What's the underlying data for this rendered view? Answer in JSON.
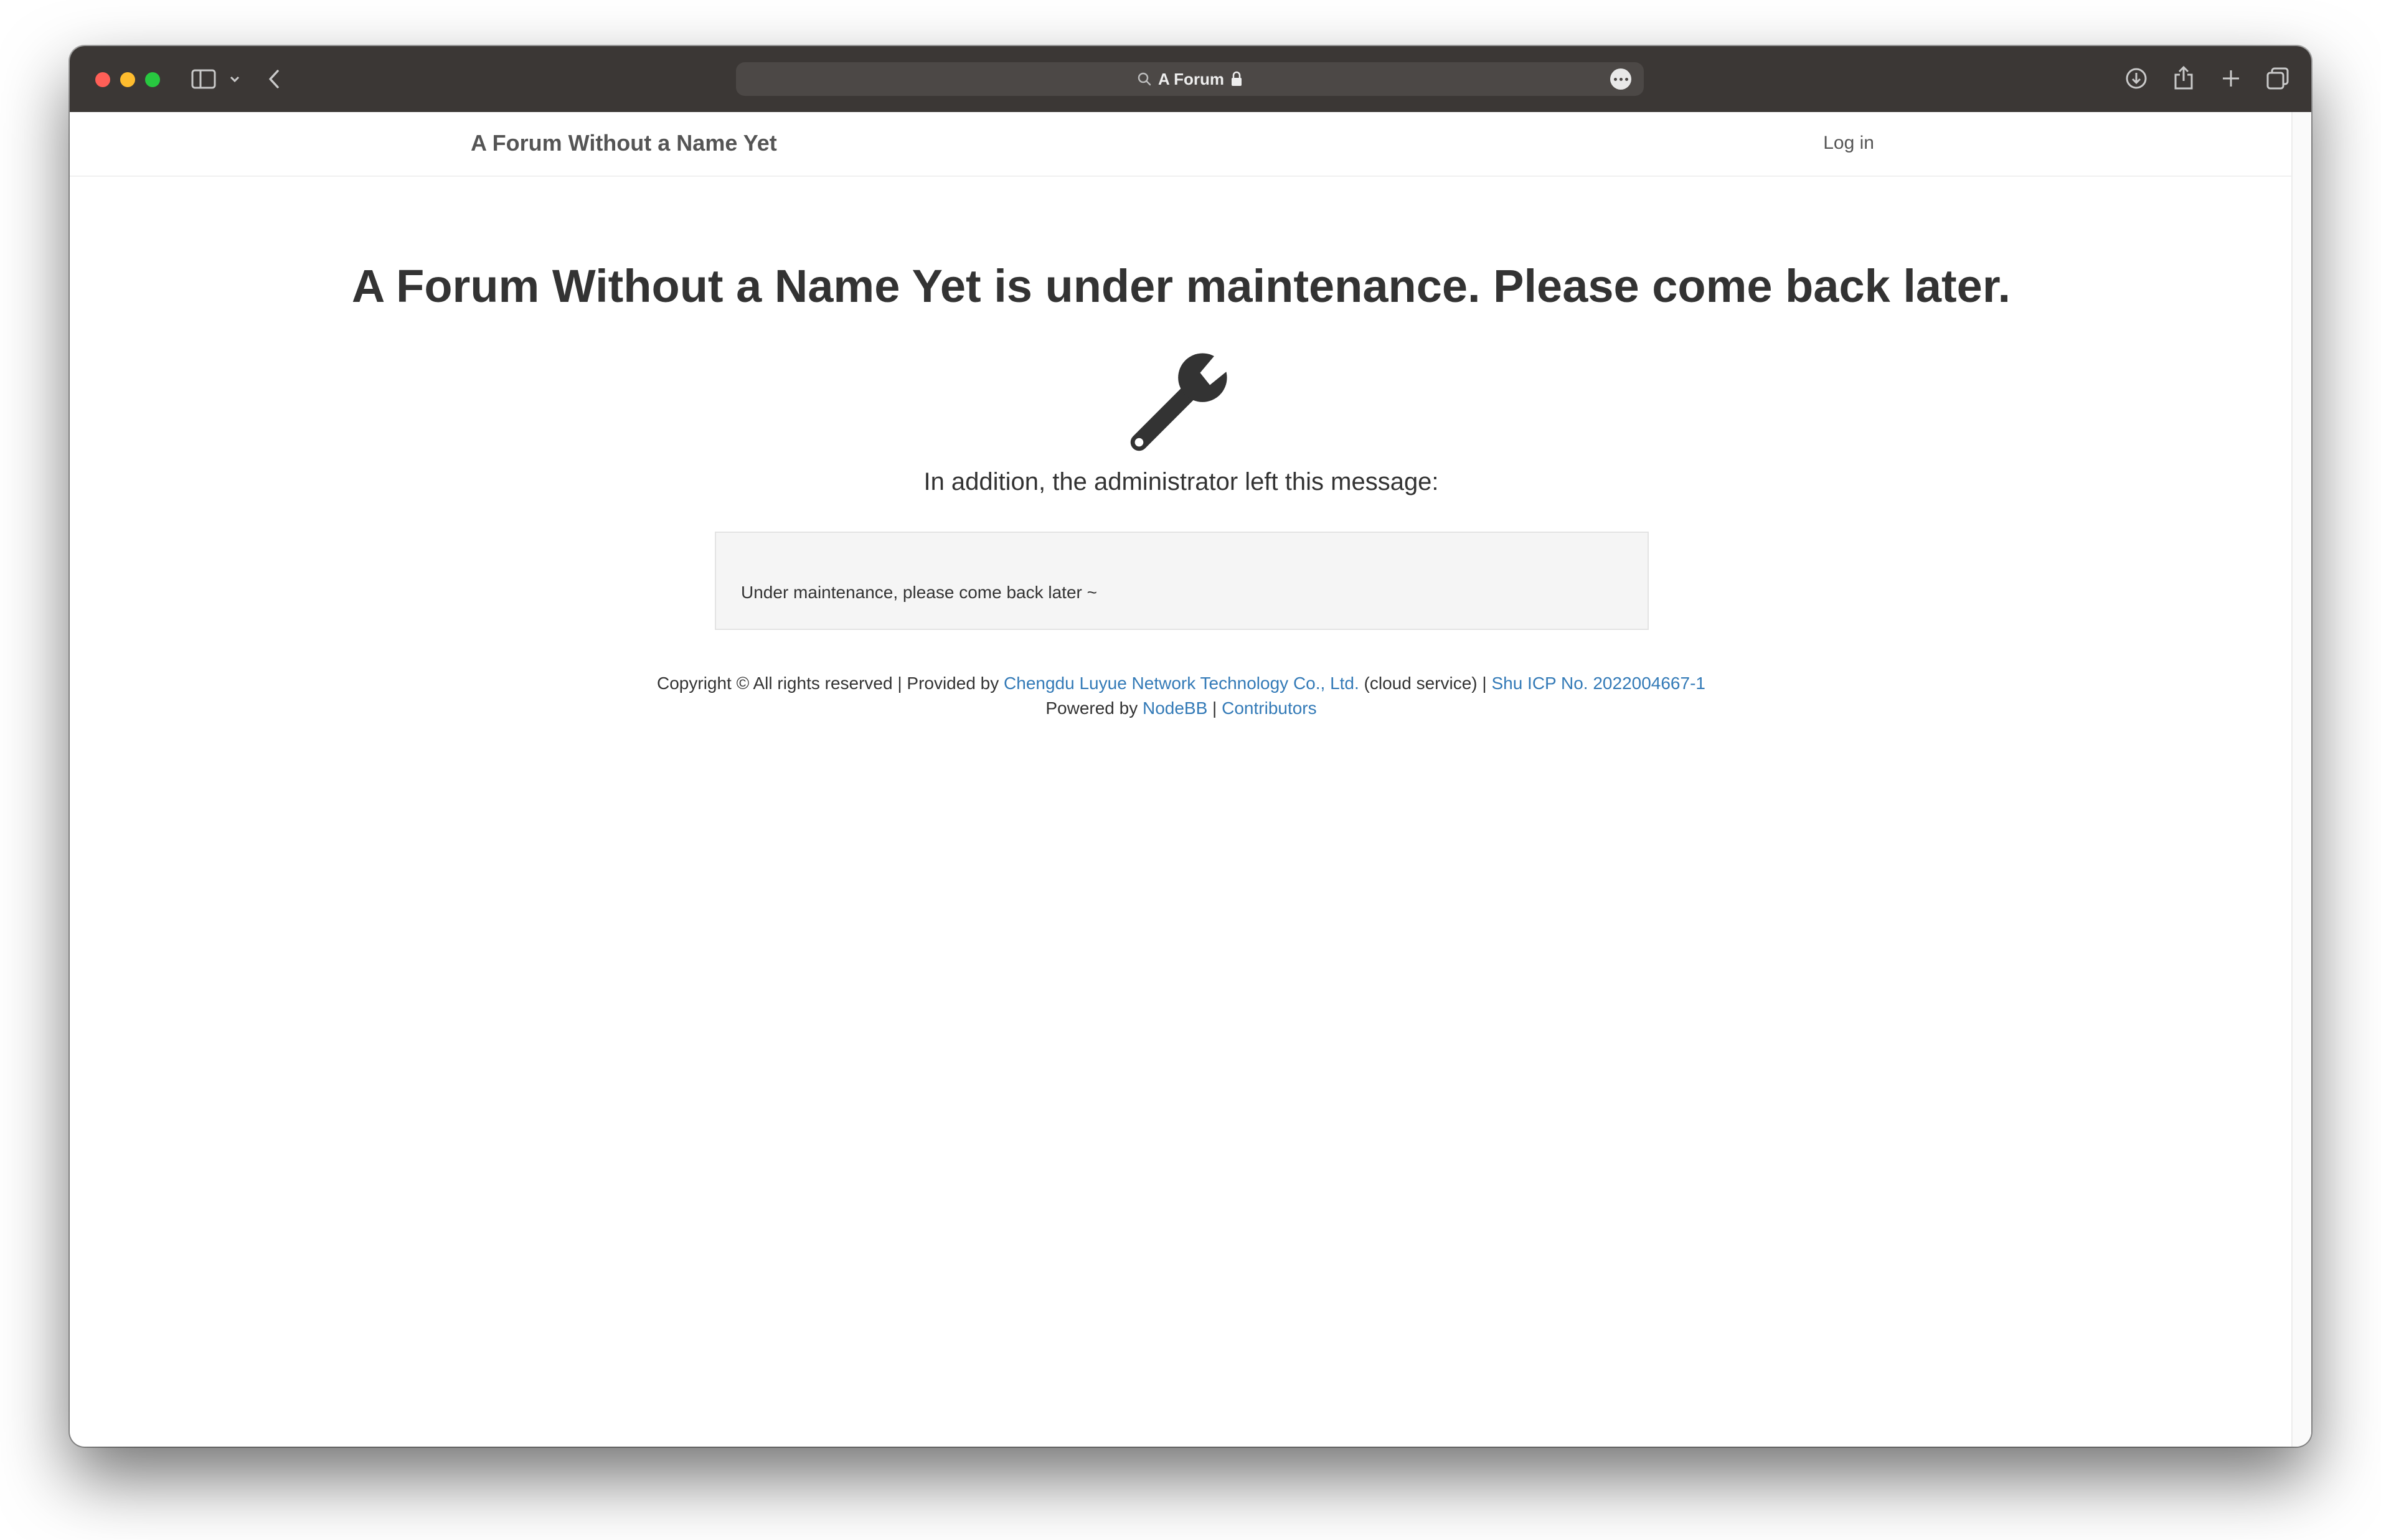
{
  "translation_note": "The strings below are English translations of Chinese text in the screenshot (brand, address bar title, login link, heading, admin message label, message text, hosting provider name, ICP filing prefix, service text). The installed fonts cannot draw CJK glyphs.",
  "browser": {
    "address_title": "A Forum",
    "icons": {
      "sidebar": "sidebar-icon",
      "chevron": "chevron-down-icon",
      "back": "back-arrow-icon",
      "search": "search-icon",
      "lock": "lock-icon",
      "more": "more-options-icon",
      "download": "download-icon",
      "share": "share-icon",
      "new_tab": "plus-icon",
      "tabs": "tab-overview-icon"
    }
  },
  "navbar": {
    "brand": "A Forum Without a Name Yet",
    "login": "Log in"
  },
  "maintenance": {
    "heading": "A Forum Without a Name Yet is under maintenance. Please come back later.",
    "icon": "wrench-icon",
    "admin_label": "In addition, the administrator left this message:",
    "message": "Under maintenance, please come back later ~"
  },
  "footer": {
    "copyright": "Copyright © All rights reserved | Provided by ",
    "host_link": "Chengdu Luyue Network Technology Co., Ltd.",
    "host_suffix": " (cloud service) | ",
    "icp_link": "Shu ICP No. 2022004667-1",
    "powered_by": "Powered by ",
    "nodebb_link": "NodeBB",
    "separator": " | ",
    "contributors_link": "Contributors"
  },
  "colors": {
    "titlebar": "#3b3735",
    "link": "#337ab7",
    "text": "#333333",
    "message_bg": "#f5f5f5"
  }
}
